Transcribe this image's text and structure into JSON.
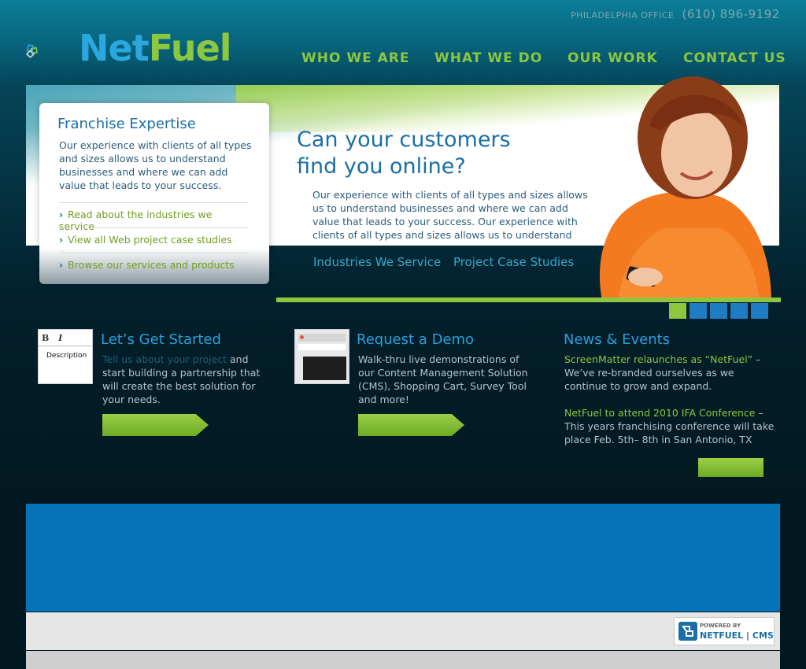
{
  "header": {
    "office_label": "PHILADELPHIA OFFICE",
    "phone": "(610) 896-9192",
    "logo_net": "Net",
    "logo_fuel": "Fuel"
  },
  "nav": [
    "WHO WE ARE",
    "WHAT WE DO",
    "OUR WORK",
    "CONTACT US"
  ],
  "franchise": {
    "title": "Franchise Expertise",
    "text": "Our experience with clients of all types and sizes allows us to understand businesses and where we can add value that leads to your success.",
    "links": [
      "Read about the industries we service",
      "View all Web project case studies",
      "Browse our services and products"
    ]
  },
  "hero": {
    "title_line1": "Can your customers",
    "title_line2": "find you online?",
    "text": "Our experience with clients of all types and sizes allows us to understand  businesses and where we can add value that leads to your success. Our experience with clients of all types and sizes allows us to understand",
    "link1": "Industries We Service",
    "link2": "Project Case Studies"
  },
  "columns": {
    "start": {
      "title": "Let’s Get Started",
      "link": "Tell us about your project",
      "text": " and start building a partnership that will create the best solution for your needs.",
      "thumb_bold": "B",
      "thumb_italic": "I",
      "thumb_field": "Description"
    },
    "demo": {
      "title": "Request a Demo",
      "text": "Walk-thru live demonstrations of our Content Management Solution (CMS), Shopping Cart, Survey Tool and more!"
    },
    "news": {
      "title": "News & Events",
      "item1_head": "ScreenMatter relaunches as “NetFuel”",
      "item1_text": " – We’ve re-branded ourselves as we continue to grow and expand.",
      "item2_head": "NetFuel to attend 2010 IFA Conference",
      "item2_text": " – This years franchising conference will take place Feb. 5th– 8th in San Antonio, TX"
    }
  },
  "footer": {
    "powered_by": "POWERED BY",
    "cms_name": "NETFUEL",
    "cms_suffix": "CMS"
  },
  "colors": {
    "accent_green": "#8dc63f",
    "accent_blue": "#2aa7df",
    "panel_blue": "#0672b8"
  }
}
